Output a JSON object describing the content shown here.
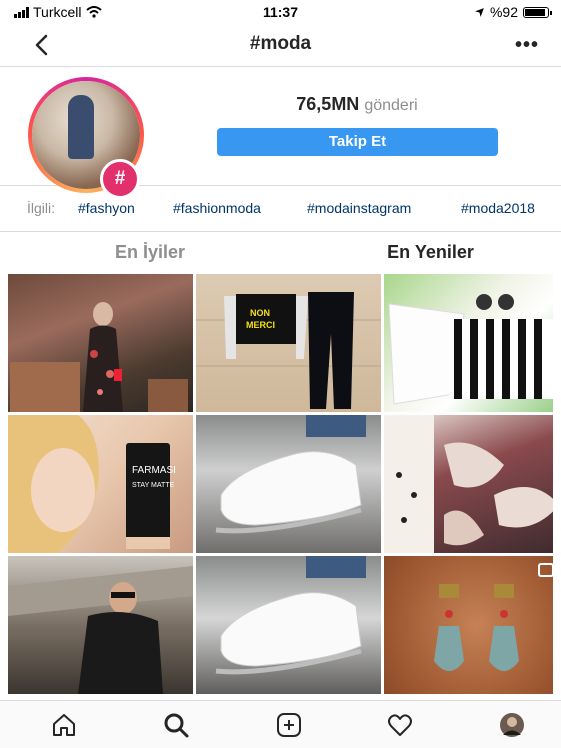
{
  "status": {
    "carrier": "Turkcell",
    "time": "11:37",
    "battery": "%92"
  },
  "nav": {
    "title": "#moda"
  },
  "profile": {
    "count": "76,5MN",
    "count_label": "gönderi",
    "follow_label": "Takip Et",
    "badge": "#"
  },
  "related": {
    "label": "İlgili:",
    "tags": [
      "#fashyon",
      "#fashionmoda",
      "#modainstagram",
      "#moda2018"
    ]
  },
  "tabs": {
    "top": "En İyiler",
    "recent": "En Yeniler"
  },
  "grid": {
    "farmasi_brand": "FARMASI",
    "farmasi_product": "STAY MATTE",
    "shirt_text": "NON MERCI"
  },
  "icons": {
    "back": "chevron-left-icon",
    "more": "ellipsis-icon",
    "home": "home-icon",
    "search": "search-icon",
    "add": "add-post-icon",
    "activity": "heart-icon",
    "profile": "profile-avatar-icon"
  }
}
